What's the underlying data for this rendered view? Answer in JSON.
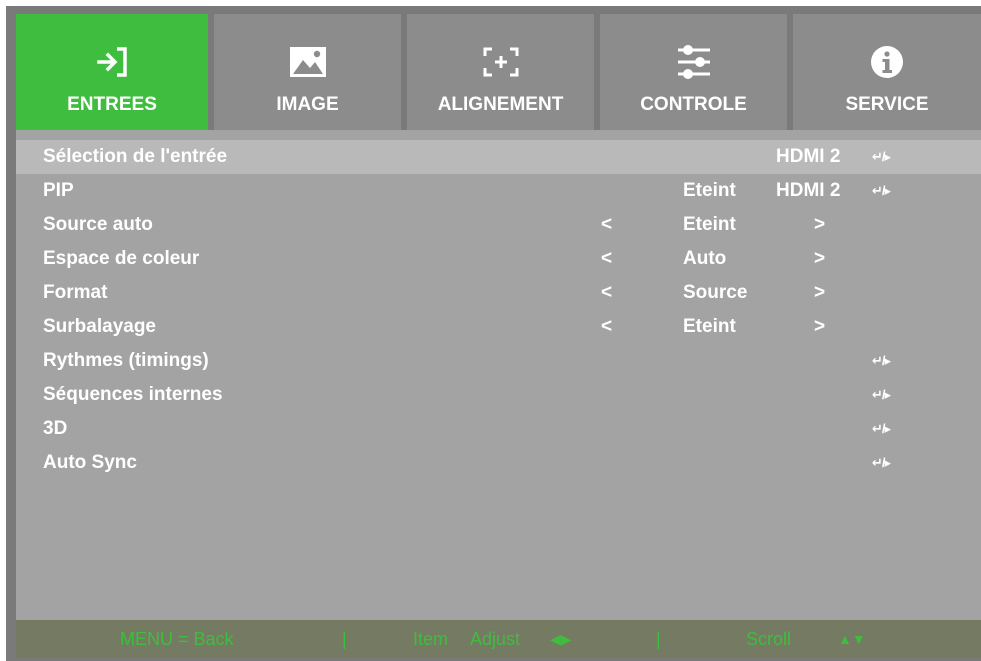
{
  "tabs": [
    {
      "label": "ENTREES",
      "icon": "input-icon",
      "active": true
    },
    {
      "label": "IMAGE",
      "icon": "image-icon",
      "active": false
    },
    {
      "label": "ALIGNEMENT",
      "icon": "alignment-icon",
      "active": false
    },
    {
      "label": "CONTROLE",
      "icon": "sliders-icon",
      "active": false
    },
    {
      "label": "SERVICE",
      "icon": "info-icon",
      "active": false
    }
  ],
  "menu": {
    "rows": [
      {
        "label": "Sélection de l'entrée",
        "source": "HDMI 2",
        "enter": "↵/▸"
      },
      {
        "label": "PIP",
        "value": "Eteint",
        "source": "HDMI 2",
        "enter": "↵/▸"
      },
      {
        "label": "Source auto",
        "left_arrow": "<",
        "value": "Eteint",
        "right_arrow": ">"
      },
      {
        "label": "Espace de coleur",
        "left_arrow": "<",
        "value": "Auto",
        "right_arrow": ">"
      },
      {
        "label": "Format",
        "left_arrow": "<",
        "value": "Source",
        "right_arrow": ">"
      },
      {
        "label": "Surbalayage",
        "left_arrow": "<",
        "value": "Eteint",
        "right_arrow": ">"
      },
      {
        "label": "Rythmes (timings)",
        "enter": "↵/▸"
      },
      {
        "label": "Séquences internes",
        "enter": "↵/▸"
      },
      {
        "label": "3D",
        "enter": "↵/▸"
      },
      {
        "label": "Auto Sync",
        "enter": "↵/▸"
      }
    ]
  },
  "footer": {
    "back": "MENU = Back",
    "divider": "|",
    "item": "Item",
    "adjust": "Adjust",
    "left_right": "◀▶",
    "scroll": "Scroll",
    "up_down": "▲▼"
  },
  "colors": {
    "accent_green": "#3ebd3e",
    "tab_inactive": "#8c8c8c",
    "menu_background": "#a3a3a3",
    "selected_row": "#b9b9b9",
    "footer_background": "#757a62"
  }
}
